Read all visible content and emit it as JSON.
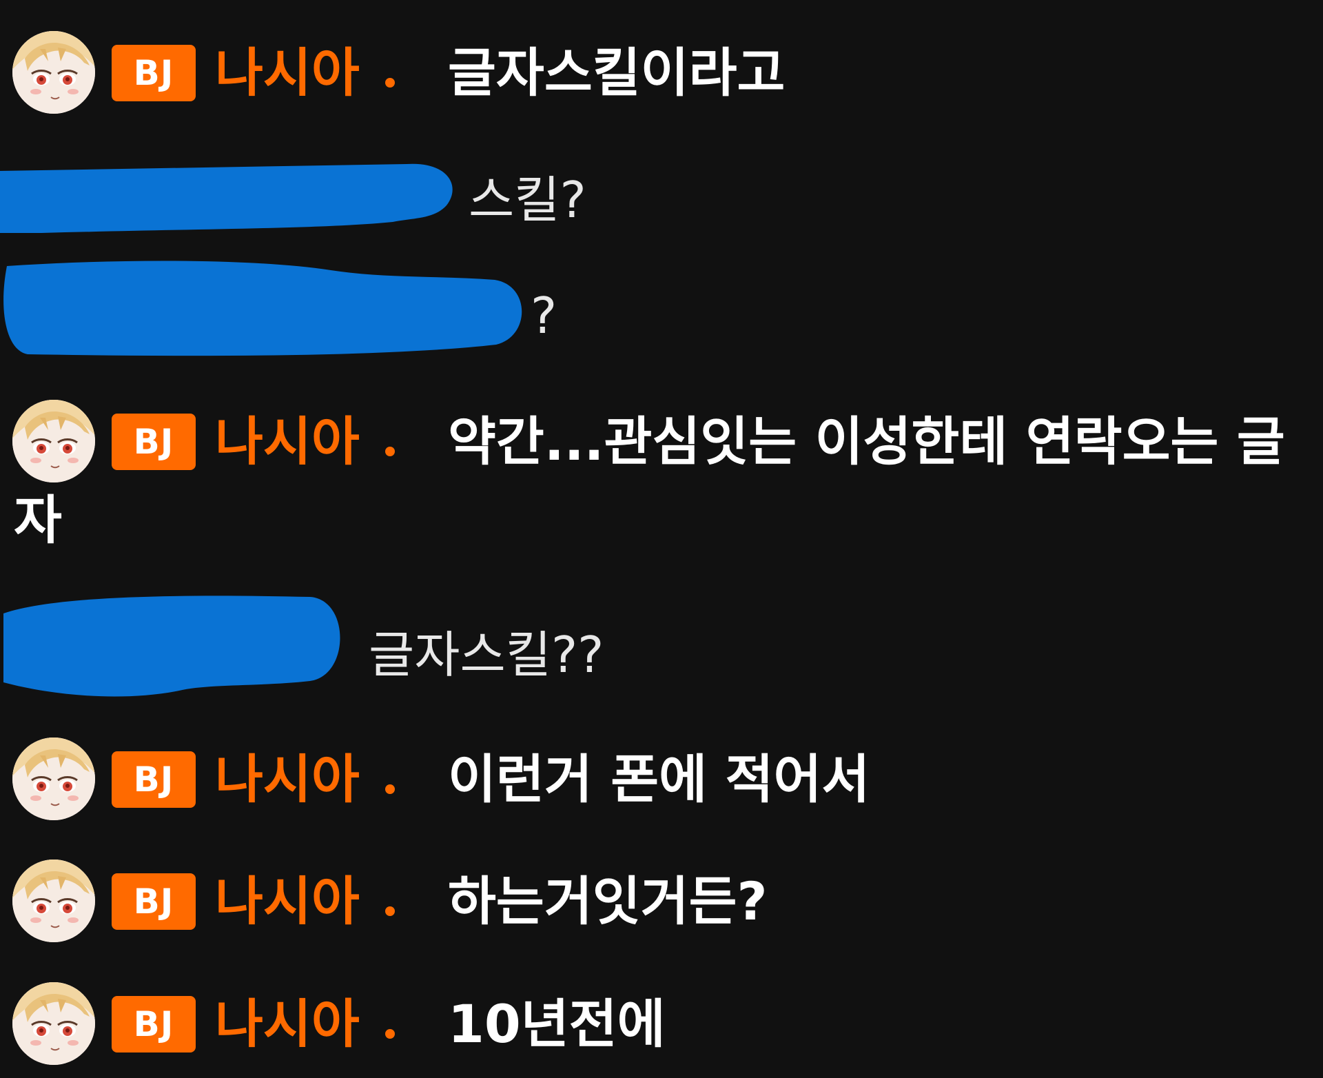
{
  "badge_label": "BJ",
  "streamer_name": "나시아",
  "colors": {
    "background": "#111111",
    "accent": "#ff6a00",
    "redaction": "#0a73d4",
    "message": "#ffffff",
    "viewer_message": "#e8e8e8"
  },
  "messages": [
    {
      "role": "bj",
      "author": "나시아",
      "badge": "BJ",
      "text": "글자스킬이라고"
    },
    {
      "role": "viewer",
      "author_redacted": true,
      "text": "스킬?"
    },
    {
      "role": "viewer",
      "author_redacted": true,
      "text": "?"
    },
    {
      "role": "bj",
      "author": "나시아",
      "badge": "BJ",
      "text": "약간...관심잇는 이성한테 연락오는 글",
      "text_wrap": "자"
    },
    {
      "role": "viewer",
      "author_redacted": true,
      "text": "글자스킬??"
    },
    {
      "role": "bj",
      "author": "나시아",
      "badge": "BJ",
      "text": "이런거 폰에 적어서"
    },
    {
      "role": "bj",
      "author": "나시아",
      "badge": "BJ",
      "text": "하는거잇거든?"
    },
    {
      "role": "bj",
      "author": "나시아",
      "badge": "BJ",
      "text": "10년전에"
    }
  ]
}
